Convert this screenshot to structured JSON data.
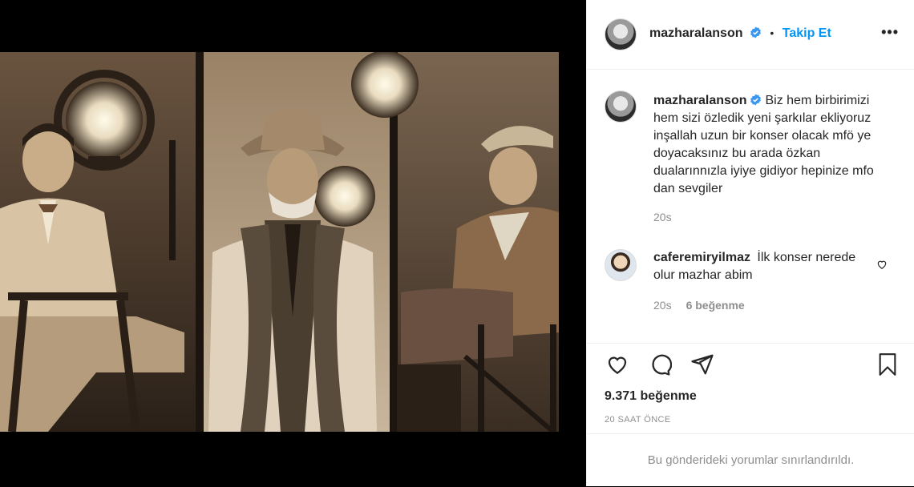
{
  "post": {
    "author": "mazharalanson",
    "follow_label": "Takip Et",
    "dot": "•",
    "more_label": "•••",
    "caption": "Biz hem birbirimizi hem sizi özledik yeni şarkılar ekliyoruz inşallah uzun bir konser olacak mfö ye doyacaksınız bu arada özkan dualarınnızla iyiye gidiyor hepinize mfo dan sevgiler",
    "caption_time": "20s",
    "comments": [
      {
        "author": "caferemiryilmaz",
        "text": "İlk konser nerede olur mazhar abim",
        "time": "20s",
        "likes": "6 beğenme"
      }
    ],
    "like_count": "9.371 beğenme",
    "posted": "20 SAAT ÖNCE",
    "comments_restricted": "Bu gönderideki yorumlar sınırlandırıldı."
  },
  "colors": {
    "accent": "#0095f6",
    "muted": "#8e8e8e",
    "text": "#262626",
    "photo_tone": "#b89c7a"
  },
  "icons": [
    "verified-badge-icon",
    "more-options-icon",
    "heart-icon",
    "comment-icon",
    "share-icon",
    "bookmark-icon"
  ]
}
